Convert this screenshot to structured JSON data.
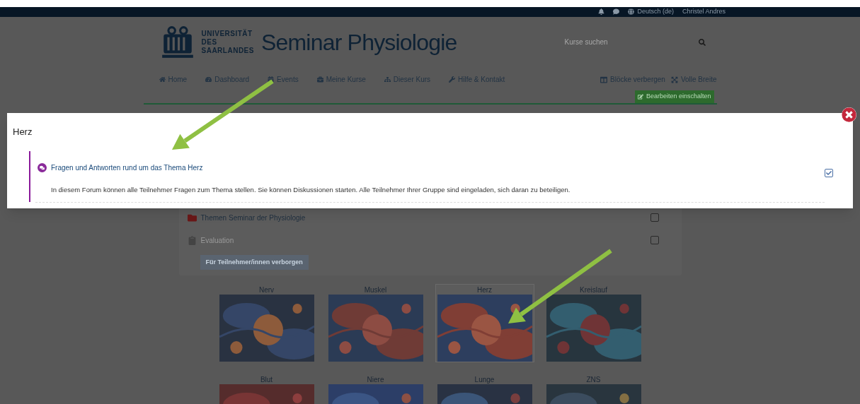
{
  "top_bar": {
    "language": "Deutsch (de)",
    "user": "Christel Andres"
  },
  "header": {
    "logo_lines": [
      "UNIVERSITÄT",
      "DES",
      "SAARLANDES"
    ],
    "title": "Seminar Physiologie",
    "search": {
      "placeholder": "Kurse suchen"
    }
  },
  "nav": {
    "items": [
      "Home",
      "Dashboard",
      "Events",
      "Meine Kurse",
      "Dieser Kurs",
      "Hilfe & Kontakt"
    ],
    "right_items": [
      "Blöcke verbergen",
      "Volle Breite"
    ],
    "edit_button": "Bearbeiten einschalten"
  },
  "activities": [
    {
      "title": "Themen Seminar der Physiologie",
      "kind": "folder",
      "checked": false
    },
    {
      "title": "Evaluation",
      "kind": "feedback",
      "checked": false
    }
  ],
  "hidden_badge": "Für Teilnehmer/innen verborgen",
  "tiles": [
    {
      "label": "Nerv",
      "selected": false
    },
    {
      "label": "Muskel",
      "selected": false
    },
    {
      "label": "Herz",
      "selected": true
    },
    {
      "label": "Kreislauf",
      "selected": false
    },
    {
      "label": "Blut",
      "selected": false
    },
    {
      "label": "Niere",
      "selected": false
    },
    {
      "label": "Lunge",
      "selected": false
    },
    {
      "label": "ZNS",
      "selected": false
    }
  ],
  "modal": {
    "title": "Herz",
    "activity": {
      "title": "Fragen und Antworten rund um das Thema Herz",
      "description": "In diesem Forum können alle Teilnehmer Fragen zum Thema stellen. Sie können Diskussionen starten. Alle Teilnehmer Ihrer Gruppe sind eingeladen, sich daran zu beteiligen.",
      "checked": true
    }
  }
}
